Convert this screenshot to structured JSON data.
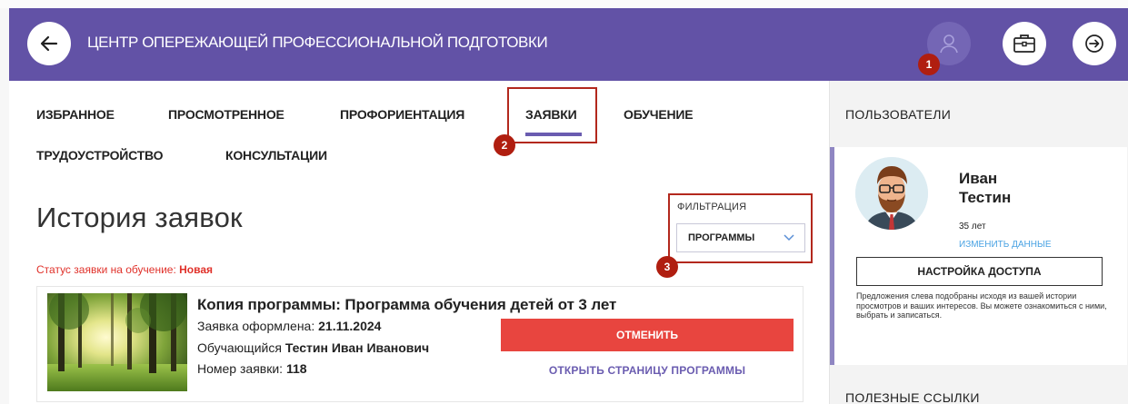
{
  "header": {
    "title": "ЦЕНТР ОПЕРЕЖАЮЩЕЙ ПРОФЕССИОНАЛЬНОЙ ПОДГОТОВКИ",
    "icons": [
      "arrow-left-icon",
      "user-icon",
      "briefcase-icon",
      "logout-icon"
    ],
    "bg_color": "#6252a6"
  },
  "annotations": {
    "badge1": "1",
    "badge2": "2",
    "badge3": "3",
    "color": "#b01e10"
  },
  "tabs": [
    {
      "label": "ИЗБРАННОЕ"
    },
    {
      "label": "ПРОСМОТРЕННОЕ"
    },
    {
      "label": "ПРОФОРИЕНТАЦИЯ"
    },
    {
      "label": "ЗАЯВКИ",
      "active": true
    },
    {
      "label": "ОБУЧЕНИЕ"
    },
    {
      "label": "ТРУДОУСТРОЙСТВО"
    },
    {
      "label": "КОНСУЛЬТАЦИИ"
    }
  ],
  "page": {
    "title": "История заявок",
    "filter_label": "ФИЛЬТРАЦИЯ",
    "filter_value": "ПРОГРАММЫ",
    "status_prefix": "Статус заявки на обучение:",
    "status_value": "Новая"
  },
  "application": {
    "title": "Копия программы: Программа обучения детей от 3 лет",
    "date_label": "Заявка оформлена:",
    "date_value": "21.11.2024",
    "student_label": "Обучающийся",
    "student_value": "Тестин Иван Иванович",
    "number_label": "Номер заявки:",
    "number_value": "118",
    "cancel_label": "ОТМЕНИТЬ",
    "open_label": "ОТКРЫТЬ СТРАНИЦУ ПРОГРАММЫ",
    "cancel_color": "#e8453f"
  },
  "sidebar": {
    "title": "ПОЛЬЗОВАТЕЛИ",
    "user_first": "Иван",
    "user_last": "Тестин",
    "user_age": "35 лет",
    "edit_label": "ИЗМЕНИТЬ ДАННЫЕ",
    "access_label": "НАСТРОЙКА ДОСТУПА",
    "note": "Предложения слева подобраны исходя из вашей истории просмотров и ваших интересов. Вы можете ознакомиться с ними, выбрать и записаться.",
    "links_title": "ПОЛЕЗНЫЕ ССЫЛКИ"
  }
}
